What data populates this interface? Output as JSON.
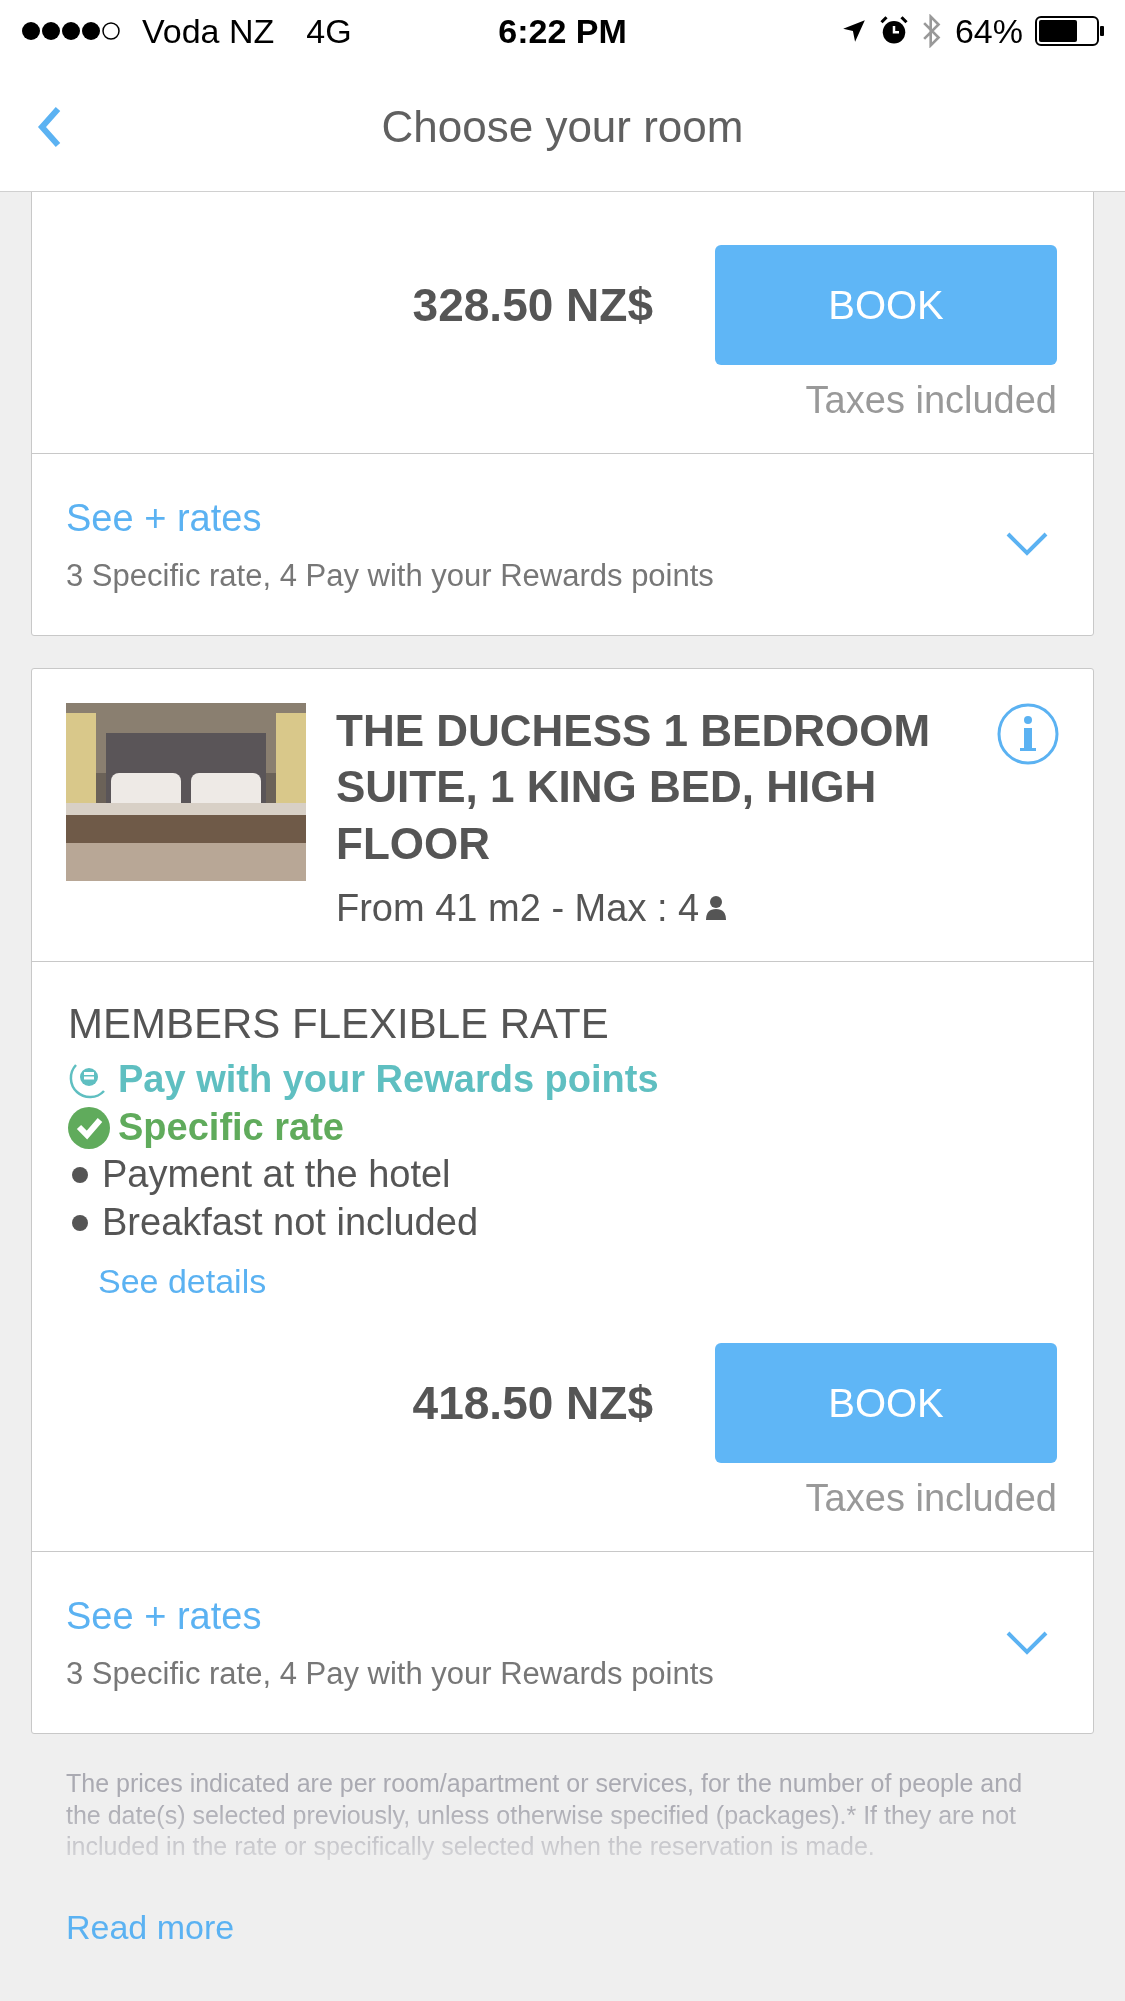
{
  "status_bar": {
    "carrier": "Voda NZ",
    "network": "4G",
    "time": "6:22 PM",
    "battery": "64%"
  },
  "nav": {
    "title": "Choose your room"
  },
  "rooms": [
    {
      "rates": [
        {
          "price": "328.50 NZ$",
          "book": "BOOK",
          "taxes": "Taxes included"
        }
      ],
      "more_rates": {
        "link": "See + rates",
        "summary": "3 Specific rate, 4 Pay with your Rewards points"
      }
    },
    {
      "header": {
        "kind": "picture",
        "title": "THE DUCHESS 1 BEDROOM SUITE, 1 KING BED, HIGH FLOOR",
        "size": "From 41 m2 - Max : 4"
      },
      "rates": [
        {
          "name": "MEMBERS FLEXIBLE RATE",
          "features": [
            {
              "kind": "rewards",
              "text": "Pay with your Rewards points"
            },
            {
              "kind": "specific",
              "text": "Specific rate"
            },
            {
              "kind": "bullet",
              "text": "Payment at the hotel"
            },
            {
              "kind": "bullet",
              "text": "Breakfast not included"
            }
          ],
          "details": "See details",
          "price": "418.50 NZ$",
          "book": "BOOK",
          "taxes": "Taxes included"
        }
      ],
      "more_rates": {
        "link": "See + rates",
        "summary": "3 Specific rate, 4 Pay with your Rewards points"
      }
    }
  ],
  "footer": {
    "notice": "The prices indicated are per room/apartment or services, for the number of people and the date(s) selected previously, unless otherwise specified (packages).* If they are not included in the rate or specifically selected when the reservation is made.",
    "read_more": "Read more"
  }
}
